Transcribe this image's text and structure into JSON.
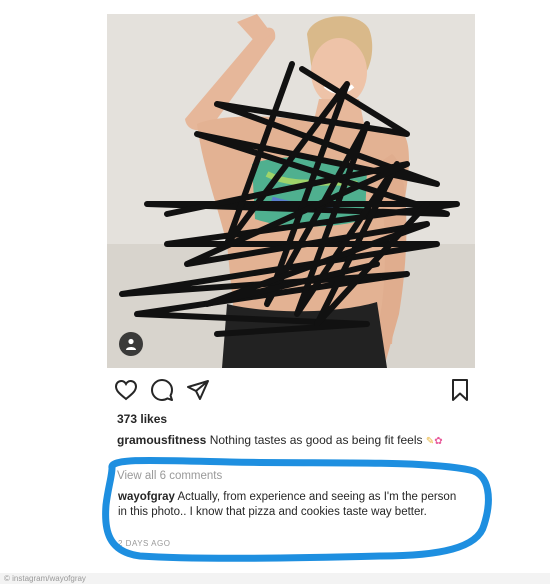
{
  "post": {
    "likes_text": "373 likes",
    "caption": {
      "username": "gramousfitness",
      "text": " Nothing tastes as good as being fit feels"
    },
    "view_comments": "View all 6 comments",
    "comment": {
      "username": "wayofgray",
      "text": " Actually, from experience and seeing as I'm the person in this photo.. I know that pizza and cookies taste way better."
    },
    "timestamp": "2 DAYS AGO"
  },
  "icons": {
    "heart": "heart-icon",
    "comment": "comment-icon",
    "share": "send-icon",
    "save": "bookmark-icon",
    "user_tag": "person-icon"
  },
  "credit": "© instagram/wayofgray",
  "colors": {
    "highlight": "#1e8fe0",
    "scribble": "#111111",
    "muted_text": "#999999"
  }
}
